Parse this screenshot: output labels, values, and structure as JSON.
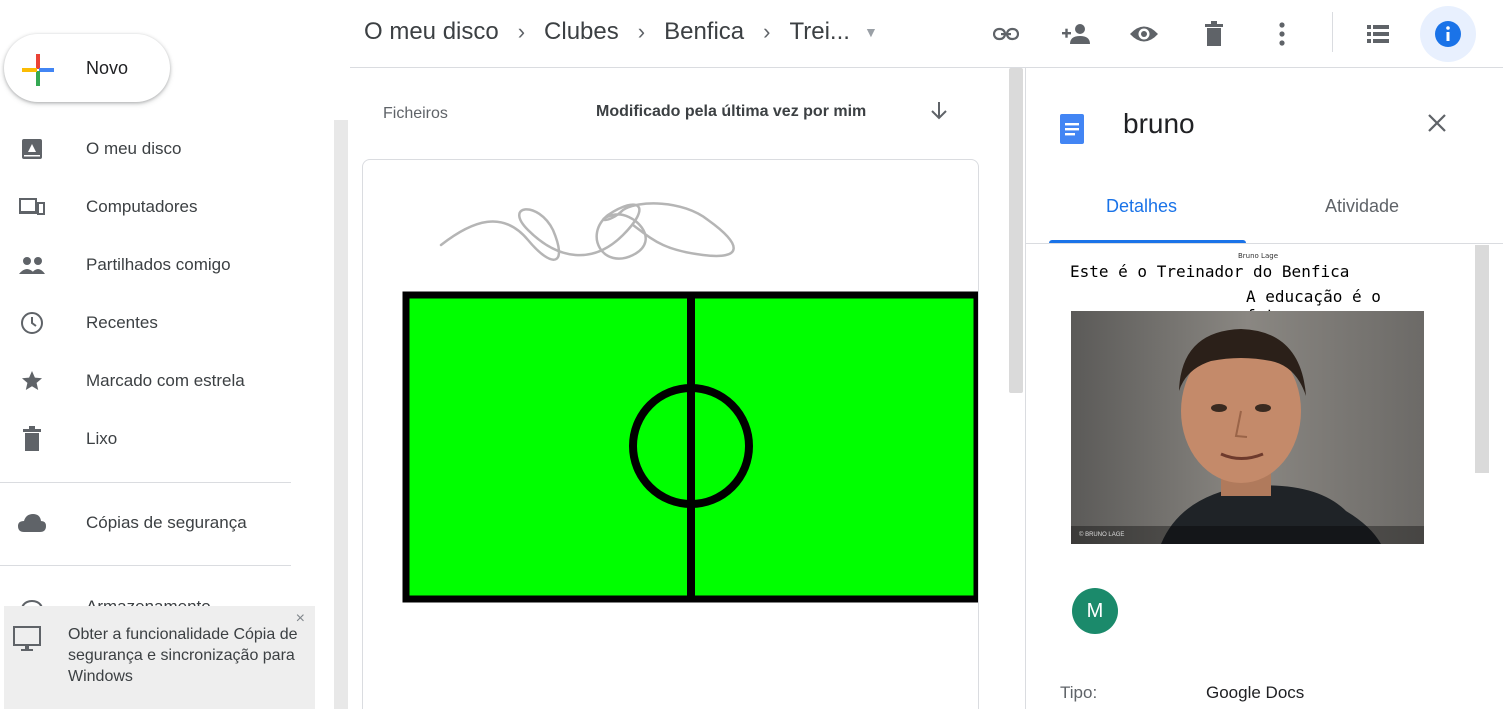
{
  "sidebar": {
    "new_label": "Novo",
    "items": [
      {
        "label": "O meu disco",
        "icon": "my-drive-icon"
      },
      {
        "label": "Computadores",
        "icon": "computers-icon"
      },
      {
        "label": "Partilhados comigo",
        "icon": "shared-icon"
      },
      {
        "label": "Recentes",
        "icon": "clock-icon"
      },
      {
        "label": "Marcado com estrela",
        "icon": "star-icon"
      },
      {
        "label": "Lixo",
        "icon": "trash-icon"
      },
      {
        "label": "Cópias de segurança",
        "icon": "cloud-icon"
      },
      {
        "label": "Armazenamento",
        "icon": "storage-icon"
      }
    ],
    "promo_text": "Obter a funcionalidade Cópia de segurança e sincronização para Windows",
    "promo_close": "×"
  },
  "breadcrumb": {
    "items": [
      "O meu disco",
      "Clubes",
      "Benfica",
      "Trei..."
    ],
    "separator": "›"
  },
  "toolbar": {
    "icons": [
      "link-icon",
      "add-person-icon",
      "preview-icon",
      "trash-icon",
      "more-vert-icon",
      "list-view-icon",
      "info-icon"
    ]
  },
  "files": {
    "header_label": "Ficheiros",
    "sort_label": "Modificado pela última vez por mim"
  },
  "details": {
    "title": "bruno",
    "tabs": [
      "Detalhes",
      "Atividade"
    ],
    "preview": {
      "small_caption": "Bruno Lage",
      "line1": "Este é o Treinador do Benfica",
      "line2": "A educação é o futuro",
      "photo_caption": "© BRUNO LAGE"
    },
    "avatar_letter": "M",
    "type_label": "Tipo:",
    "type_value": "Google Docs"
  },
  "colors": {
    "accent": "#1a73e8",
    "field_green": "#00ff00",
    "avatar": "#1b8a6b"
  }
}
